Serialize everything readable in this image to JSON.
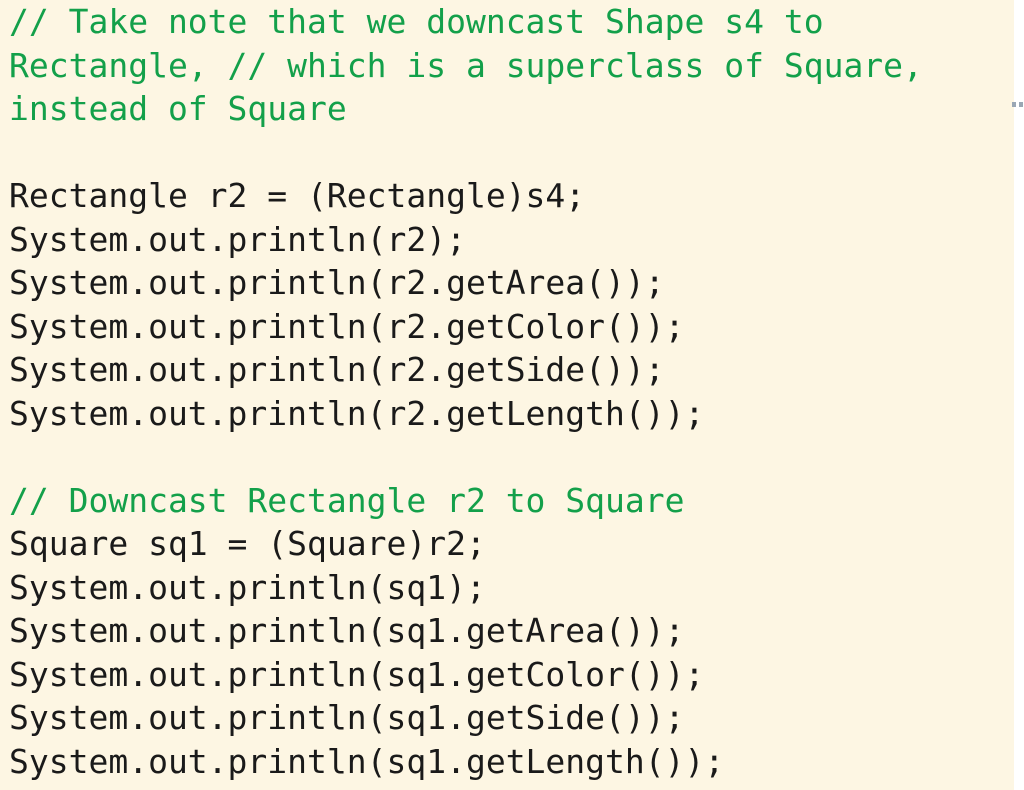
{
  "editor": {
    "background_color": "#fdf6e3",
    "comment_color": "#13a04a",
    "code_color": "#1a1a1a",
    "gutter_mark_color": "#9aa7b4",
    "lines": [
      {
        "kind": "comment",
        "text": "// Take note that we downcast Shape s4 to"
      },
      {
        "kind": "comment",
        "text": "Rectangle, // which is a superclass of Square,"
      },
      {
        "kind": "comment",
        "text": "instead of Square"
      },
      {
        "kind": "blank",
        "text": ""
      },
      {
        "kind": "code",
        "text": "Rectangle r2 = (Rectangle)s4;"
      },
      {
        "kind": "code",
        "text": "System.out.println(r2);"
      },
      {
        "kind": "code",
        "text": "System.out.println(r2.getArea());"
      },
      {
        "kind": "code",
        "text": "System.out.println(r2.getColor());"
      },
      {
        "kind": "code",
        "text": "System.out.println(r2.getSide());"
      },
      {
        "kind": "code",
        "text": "System.out.println(r2.getLength());"
      },
      {
        "kind": "blank",
        "text": ""
      },
      {
        "kind": "comment",
        "text": "// Downcast Rectangle r2 to Square"
      },
      {
        "kind": "code",
        "text": "Square sq1 = (Square)r2;"
      },
      {
        "kind": "code",
        "text": "System.out.println(sq1);"
      },
      {
        "kind": "code",
        "text": "System.out.println(sq1.getArea());"
      },
      {
        "kind": "code",
        "text": "System.out.println(sq1.getColor());"
      },
      {
        "kind": "code",
        "text": "System.out.println(sq1.getSide());"
      },
      {
        "kind": "code",
        "text": "System.out.println(sq1.getLength());"
      }
    ]
  }
}
